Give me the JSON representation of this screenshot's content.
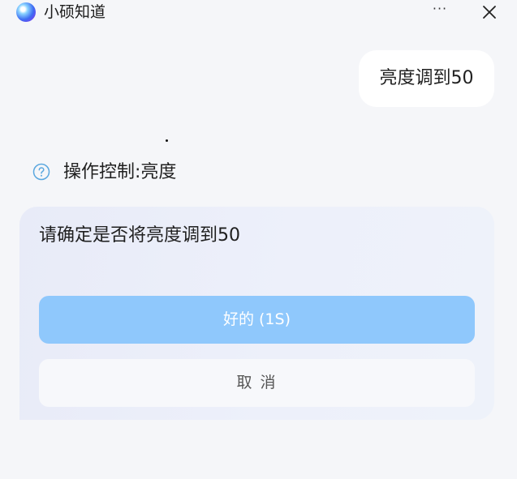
{
  "window": {
    "title": "小硕知道",
    "more_label": "···",
    "icons": {
      "app": "app-logo-icon",
      "more": "more-icon",
      "close": "close-icon"
    }
  },
  "chat": {
    "user_message": "亮度调到50",
    "intent": {
      "icon": "help-circle-icon",
      "label": "操作控制:亮度"
    },
    "confirm": {
      "text": "请确定是否将亮度调到50",
      "ok_label": "好的 (1S)",
      "cancel_label": "取 消"
    }
  },
  "colors": {
    "background": "#f5f6f9",
    "ok_button": "#8fc8fc",
    "help_icon": "#5aa7df",
    "card": "#edf0fa"
  }
}
